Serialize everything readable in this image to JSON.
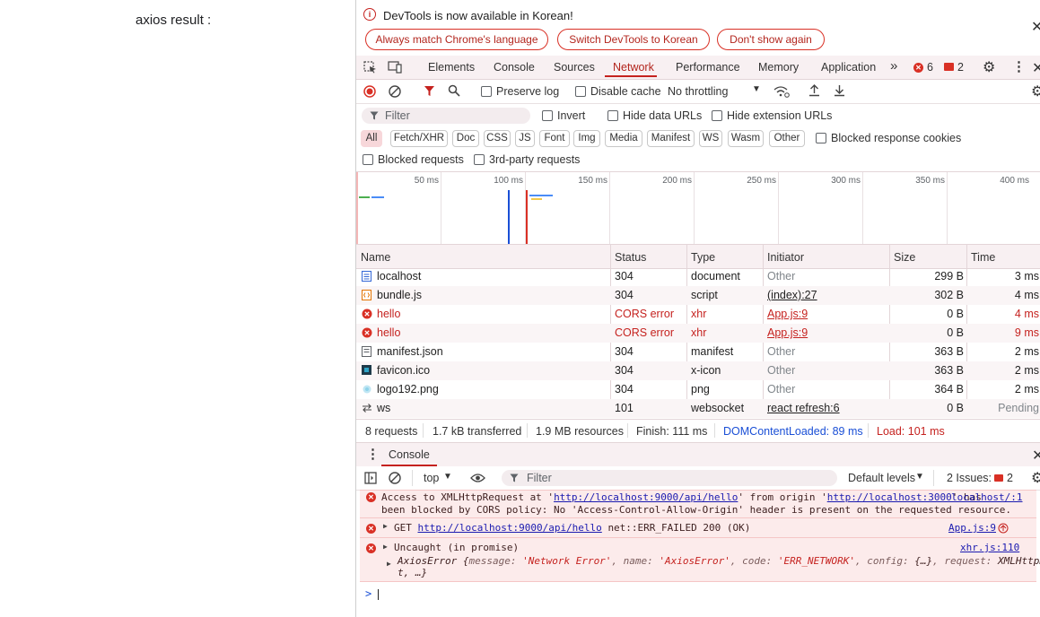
{
  "page": {
    "label": "axios result :"
  },
  "infobar": {
    "message": "DevTools is now available in Korean!",
    "buttons": [
      "Always match Chrome's language",
      "Switch DevTools to Korean",
      "Don't show again"
    ]
  },
  "tabs": {
    "items": [
      "Elements",
      "Console",
      "Sources",
      "Network",
      "Performance",
      "Memory",
      "Application"
    ],
    "active": "Network",
    "error_count": "6",
    "warning_count": "2"
  },
  "toolbar": {
    "preserve_log": "Preserve log",
    "disable_cache": "Disable cache",
    "throttling": "No throttling"
  },
  "filter": {
    "placeholder": "Filter",
    "invert": "Invert",
    "hide_data_urls": "Hide data URLs",
    "hide_extension_urls": "Hide extension URLs",
    "types": [
      "All",
      "Fetch/XHR",
      "Doc",
      "CSS",
      "JS",
      "Font",
      "Img",
      "Media",
      "Manifest",
      "WS",
      "Wasm",
      "Other"
    ],
    "blocked_response_cookies": "Blocked response cookies",
    "blocked_requests": "Blocked requests",
    "third_party_requests": "3rd-party requests"
  },
  "overview": {
    "ticks": [
      "50 ms",
      "100 ms",
      "150 ms",
      "200 ms",
      "250 ms",
      "300 ms",
      "350 ms",
      "400 ms"
    ],
    "colors": {
      "dcl_line": "#1a4fd6",
      "load_line": "#d93025"
    }
  },
  "table": {
    "columns": [
      "Name",
      "Status",
      "Type",
      "Initiator",
      "Size",
      "Time"
    ],
    "rows": [
      {
        "name": "localhost",
        "status": "304",
        "type": "document",
        "initiator": "Other",
        "size": "299 B",
        "time": "3 ms",
        "icon": "document-icon",
        "error": false,
        "initiator_link": false
      },
      {
        "name": "bundle.js",
        "status": "304",
        "type": "script",
        "initiator": "(index):27",
        "size": "302 B",
        "time": "4 ms",
        "icon": "script-icon",
        "error": false,
        "initiator_link": true
      },
      {
        "name": "hello",
        "status": "CORS error",
        "type": "xhr",
        "initiator": "App.js:9",
        "size": "0 B",
        "time": "4 ms",
        "icon": "error-icon",
        "error": true,
        "initiator_link": true
      },
      {
        "name": "hello",
        "status": "CORS error",
        "type": "xhr",
        "initiator": "App.js:9",
        "size": "0 B",
        "time": "9 ms",
        "icon": "error-icon",
        "error": true,
        "initiator_link": true
      },
      {
        "name": "manifest.json",
        "status": "304",
        "type": "manifest",
        "initiator": "Other",
        "size": "363 B",
        "time": "2 ms",
        "icon": "manifest-icon",
        "error": false,
        "initiator_link": false
      },
      {
        "name": "favicon.ico",
        "status": "304",
        "type": "x-icon",
        "initiator": "Other",
        "size": "363 B",
        "time": "2 ms",
        "icon": "favicon-icon",
        "error": false,
        "initiator_link": false
      },
      {
        "name": "logo192.png",
        "status": "304",
        "type": "png",
        "initiator": "Other",
        "size": "364 B",
        "time": "2 ms",
        "icon": "image-icon",
        "error": false,
        "initiator_link": false
      },
      {
        "name": "ws",
        "status": "101",
        "type": "websocket",
        "initiator": "react refresh:6",
        "size": "0 B",
        "time": "Pending",
        "icon": "websocket-icon",
        "error": false,
        "initiator_link": true
      }
    ]
  },
  "summary": {
    "requests": "8 requests",
    "transferred": "1.7 kB transferred",
    "resources": "1.9 MB resources",
    "finish": "Finish: 111 ms",
    "dcl": "DOMContentLoaded: 89 ms",
    "load": "Load: 101 ms"
  },
  "console": {
    "tab_label": "Console",
    "context": "top",
    "filter_placeholder": "Filter",
    "levels": "Default levels",
    "issues_label": "2 Issues:",
    "issues_count": "2",
    "messages": {
      "m1": {
        "pre": "Access to XMLHttpRequest at '",
        "url1": "http://localhost:9000/api/hello",
        "mid": "' from origin '",
        "url2": "http://localhost:3000",
        "post": "' has",
        "line2": "been blocked by CORS policy: No 'Access-Control-Allow-Origin' header is present on the requested resource.",
        "source": "localhost/:1"
      },
      "m2": {
        "method": "GET",
        "url": "http://localhost:9000/api/hello",
        "post": "net::ERR_FAILED 200 (OK)",
        "source": "App.js:9"
      },
      "m3": {
        "title": "Uncaught (in promise)",
        "source": "xhr.js:110",
        "err_name": "AxiosError",
        "k_message": "message: ",
        "v_message": "'Network Error'",
        "k_name": ", name: ",
        "v_name": "'AxiosError'",
        "k_code": ", code: ",
        "v_code": "'ERR_NETWORK'",
        "k_config": ", config: ",
        "v_config": "{…}",
        "k_request": ", request: ",
        "v_request": "XMLHttpReques",
        "line2": "t, …}"
      }
    },
    "prompt": ">"
  }
}
